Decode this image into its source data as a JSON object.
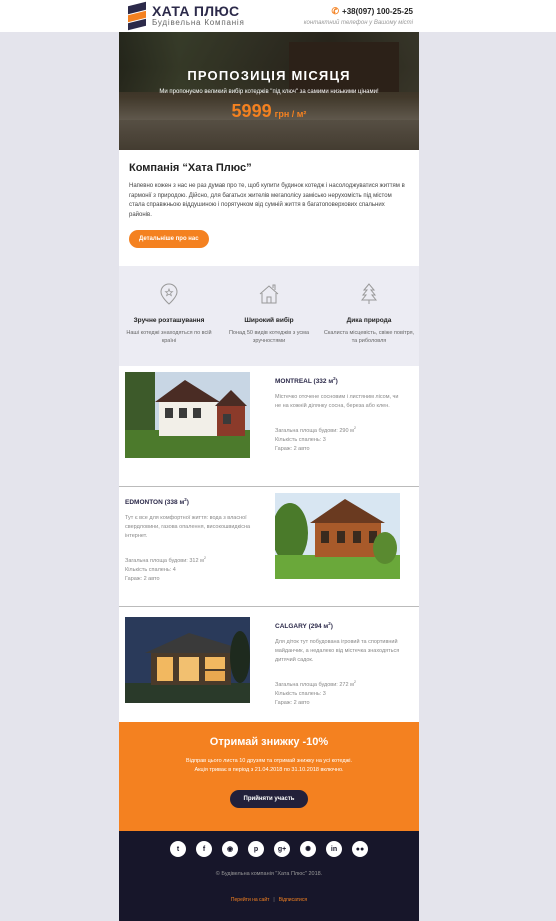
{
  "header": {
    "brand": "ХАТА ПЛЮС",
    "tagline": "Будівельна Компанія",
    "phone": "+38(097) 100-25-25",
    "phone_label": "контактний телефон у Вашому місті"
  },
  "hero": {
    "title": "ПРОПОЗИЦІЯ МІСЯЦЯ",
    "subtitle": "Ми пропонуємо великий вибір котеджів \"під ключ\" за самими низькими цінами!",
    "price": "5999",
    "unit": "грн / м²"
  },
  "company": {
    "title": "Компанія “Хата Плюс”",
    "text": "Напевно кожен з нас не раз думав про те, щоб купити будинок котедж і насолоджуватися життям в гармонії з природою. Дійсно, для багатьох жителів мегаполісу замісько нерухомість під містом стала справжньою віддушиною і порятунком від сумній життя в багатоповерхових спальних районів.",
    "button": "Детальніше про нас"
  },
  "features": [
    {
      "icon": "location-icon",
      "title": "Зручне розташування",
      "desc": "Наші котеджі знаходяться по всій країні"
    },
    {
      "icon": "house-icon",
      "title": "Широкий вибір",
      "desc": "Понад 50 видів котеджів з усма зручностями"
    },
    {
      "icon": "tree-icon",
      "title": "Дика природа",
      "desc": "Скалиста місцевість, свіже повітря, та риболовля"
    }
  ],
  "houses": [
    {
      "name": "MONTREAL",
      "area": "(332 м",
      "area_close": ")",
      "desc": "Містечко оточене сосновим і листяним лісом, чи не на кожній ділянку сосна, береза або клен.",
      "stat_area": "Загальна площа будови: 290 м",
      "stat_bedrooms": "Кількість спалень: 3",
      "stat_garage": "Гараж: 2 авто"
    },
    {
      "name": "EDMONTON",
      "area": "(338 м",
      "area_close": ")",
      "desc": "Тут є все для комфортної життя: вода з власної свердловини, газова опалення, високошвидкісна інтернет.",
      "stat_area": "Загальна площа будови: 312 м",
      "stat_bedrooms": "Кількість спалень: 4",
      "stat_garage": "Гараж: 2 авто"
    },
    {
      "name": "CALGARY",
      "area": "(294 м",
      "area_close": ")",
      "desc": "Для діток тут побудована ігровий та спортивний майданчик, а недалеко від містечка знаходяться дитячий садок.",
      "stat_area": "Загальна площа будови: 272 м",
      "stat_bedrooms": "Кількість спалень: 3",
      "stat_garage": "Гараж: 2 авто"
    }
  ],
  "sup2": "2",
  "promo": {
    "title": "Отримай знижку -10%",
    "line1": "Відправ цього листа 10 друзям та отримай знижку на усі котеджі.",
    "line2": "Акція триває в період з 21.04.2018 по 31.10.2018 включно.",
    "button": "Прийняти участь"
  },
  "footer": {
    "socials": [
      {
        "icon": "twitter-icon",
        "glyph": "t"
      },
      {
        "icon": "facebook-icon",
        "glyph": "f"
      },
      {
        "icon": "rss-icon",
        "glyph": "◉"
      },
      {
        "icon": "pinterest-icon",
        "glyph": "p"
      },
      {
        "icon": "google-plus-icon",
        "glyph": "g+"
      },
      {
        "icon": "dribbble-icon",
        "glyph": "✺"
      },
      {
        "icon": "linkedin-icon",
        "glyph": "in"
      },
      {
        "icon": "flickr-icon",
        "glyph": "●●"
      }
    ],
    "copyright": "© Будівельна компанія \"Хата Плюс\" 2018.",
    "link_site": "Перейти на сайт",
    "link_unsub": "Відписатися"
  },
  "colors": {
    "accent": "#f48120",
    "dark": "#17162a",
    "brand": "#2c2a4a"
  }
}
